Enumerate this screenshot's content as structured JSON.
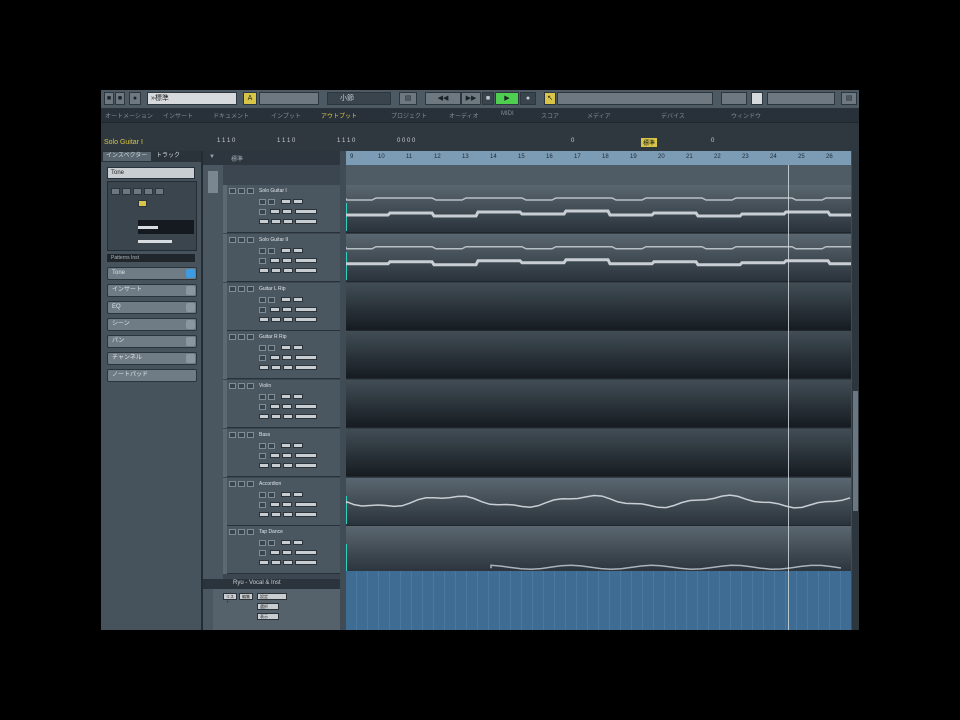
{
  "toolbar": {
    "preset_label": "»標準",
    "snap_label": "小節"
  },
  "menu_items": [
    "オートメーション",
    "インサート",
    "ドキュメント",
    "インプット",
    "アウトプット",
    "プロジェクト",
    "オーディオ",
    "MIDI",
    "スコア",
    "メディア",
    "デバイス",
    "ウィンドウ"
  ],
  "info": {
    "track_title": "Solo Guitar I",
    "values": [
      "1 1 1 0",
      "1 1 1 0",
      "1 1 1 0",
      "0 0 0 0",
      "標準",
      "0",
      "0"
    ]
  },
  "inspector": {
    "tab1": "インスペクター",
    "tab2": "トラック",
    "track_name": "Tone",
    "section_line": "Patterns Inst",
    "sections": [
      "Tone",
      "インサート",
      "EQ",
      "シーン",
      "パン",
      "チャンネル",
      "ノートパッド"
    ]
  },
  "tracklist": {
    "header": [
      "▼",
      "標準"
    ],
    "tracks": [
      {
        "name": "Solo Guitar I"
      },
      {
        "name": "Solo Guitar II"
      },
      {
        "name": "Guitar L Rip"
      },
      {
        "name": "Guitar R Rip"
      },
      {
        "name": "Violin"
      },
      {
        "name": "Bass"
      },
      {
        "name": "Accordion"
      },
      {
        "name": "Tap Dance"
      }
    ],
    "folder_label": "Ryu - Vocal & Inst",
    "lower_buttons": [
      "リスト",
      "編集",
      "設定",
      "選択",
      "表示"
    ]
  },
  "ruler_numbers": [
    "9",
    "10",
    "11",
    "12",
    "13",
    "14",
    "15",
    "16",
    "17",
    "18",
    "19",
    "20",
    "21",
    "22",
    "23",
    "24",
    "25",
    "26"
  ],
  "colors": {
    "cyan_marker": "#2ed0c2",
    "toolbar_yellow": "#d8c446",
    "toolbar_green": "#4fcf4f",
    "ruler_blue": "#7c9cb6"
  }
}
